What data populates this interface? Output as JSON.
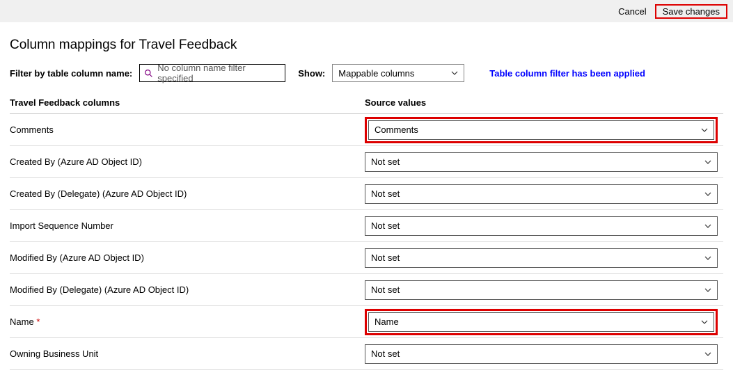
{
  "topbar": {
    "cancel": "Cancel",
    "save": "Save changes"
  },
  "page_title": "Column mappings for Travel Feedback",
  "filter": {
    "label": "Filter by table column name:",
    "input_placeholder": "No column name filter specified",
    "show_label": "Show:",
    "show_value": "Mappable columns",
    "applied_msg": "Table column filter has been applied"
  },
  "columns_header": {
    "left": "Travel Feedback columns",
    "right": "Source values"
  },
  "rows": [
    {
      "label": "Comments",
      "value": "Comments",
      "required": false,
      "highlight": true
    },
    {
      "label": "Created By (Azure AD Object ID)",
      "value": "Not set",
      "required": false,
      "highlight": false
    },
    {
      "label": "Created By (Delegate) (Azure AD Object ID)",
      "value": "Not set",
      "required": false,
      "highlight": false
    },
    {
      "label": "Import Sequence Number",
      "value": "Not set",
      "required": false,
      "highlight": false
    },
    {
      "label": "Modified By (Azure AD Object ID)",
      "value": "Not set",
      "required": false,
      "highlight": false
    },
    {
      "label": "Modified By (Delegate) (Azure AD Object ID)",
      "value": "Not set",
      "required": false,
      "highlight": false
    },
    {
      "label": "Name",
      "value": "Name",
      "required": true,
      "highlight": true
    },
    {
      "label": "Owning Business Unit",
      "value": "Not set",
      "required": false,
      "highlight": false
    }
  ]
}
